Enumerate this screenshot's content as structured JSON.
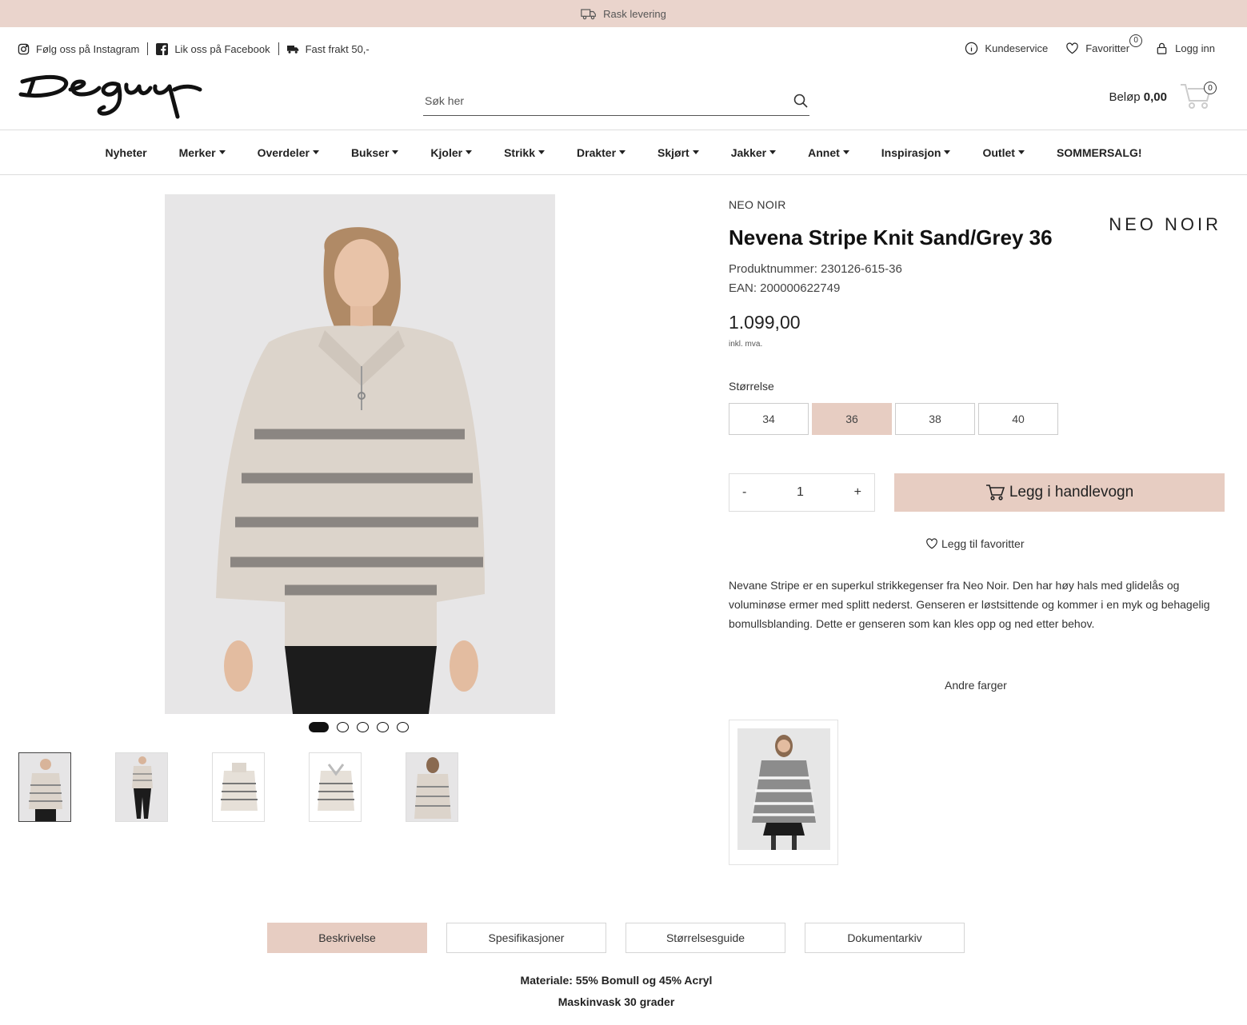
{
  "topbar": {
    "text": "Rask levering"
  },
  "util": {
    "instagram": "Følg oss på Instagram",
    "facebook": "Lik oss på Facebook",
    "shipping": "Fast frakt 50,-"
  },
  "account": {
    "service": "Kundeservice",
    "favorites": "Favoritter",
    "favorites_count": "0",
    "login": "Logg inn"
  },
  "logo": {
    "text": "Deguy"
  },
  "search": {
    "placeholder": "Søk her"
  },
  "cart": {
    "label": "Beløp",
    "amount": "0,00",
    "count": "0"
  },
  "nav": [
    {
      "label": "Nyheter",
      "caret": false
    },
    {
      "label": "Merker",
      "caret": true
    },
    {
      "label": "Overdeler",
      "caret": true
    },
    {
      "label": "Bukser",
      "caret": true
    },
    {
      "label": "Kjoler",
      "caret": true
    },
    {
      "label": "Strikk",
      "caret": true
    },
    {
      "label": "Drakter",
      "caret": true
    },
    {
      "label": "Skjørt",
      "caret": true
    },
    {
      "label": "Jakker",
      "caret": true
    },
    {
      "label": "Annet",
      "caret": true
    },
    {
      "label": "Inspirasjon",
      "caret": true
    },
    {
      "label": "Outlet",
      "caret": true
    },
    {
      "label": "SOMMERSALG!",
      "caret": false
    }
  ],
  "gallery": {
    "slides": 5,
    "active_slide": 1,
    "thumbnails": 5
  },
  "product": {
    "brand": "NEO NOIR",
    "brand_logo": "NEO NOIR",
    "title": "Nevena Stripe Knit Sand/Grey 36",
    "product_number": "Produktnummer: 230126-615-36",
    "ean": "EAN: 200000622749",
    "price": "1.099,00",
    "vat": "inkl. mva.",
    "size_label": "Størrelse",
    "sizes": [
      "34",
      "36",
      "38",
      "40"
    ],
    "selected_size": "36",
    "qty_minus": "-",
    "qty_value": "1",
    "qty_plus": "+",
    "add_to_cart": "Legg i handlevogn",
    "add_to_favorites": "Legg til favoritter",
    "description": "Nevane Stripe er en superkul strikkegenser fra Neo Noir. Den har høy hals med glidelås og voluminøse ermer med splitt nederst. Genseren er løstsittende og kommer i en myk og behagelig bomullsblanding. Dette er genseren som kan kles opp og ned etter behov.",
    "other_colors": "Andre farger"
  },
  "tabs": [
    "Beskrivelse",
    "Spesifikasjoner",
    "Størrelsesguide",
    "Dokumentarkiv"
  ],
  "active_tab": "Beskrivelse",
  "specs": {
    "material": "Materiale: 55% Bomull og 45% Acryl",
    "wash": "Maskinvask 30 grader"
  },
  "colors": {
    "accent": "#e7cdc2",
    "topbar": "#ead4cc"
  }
}
